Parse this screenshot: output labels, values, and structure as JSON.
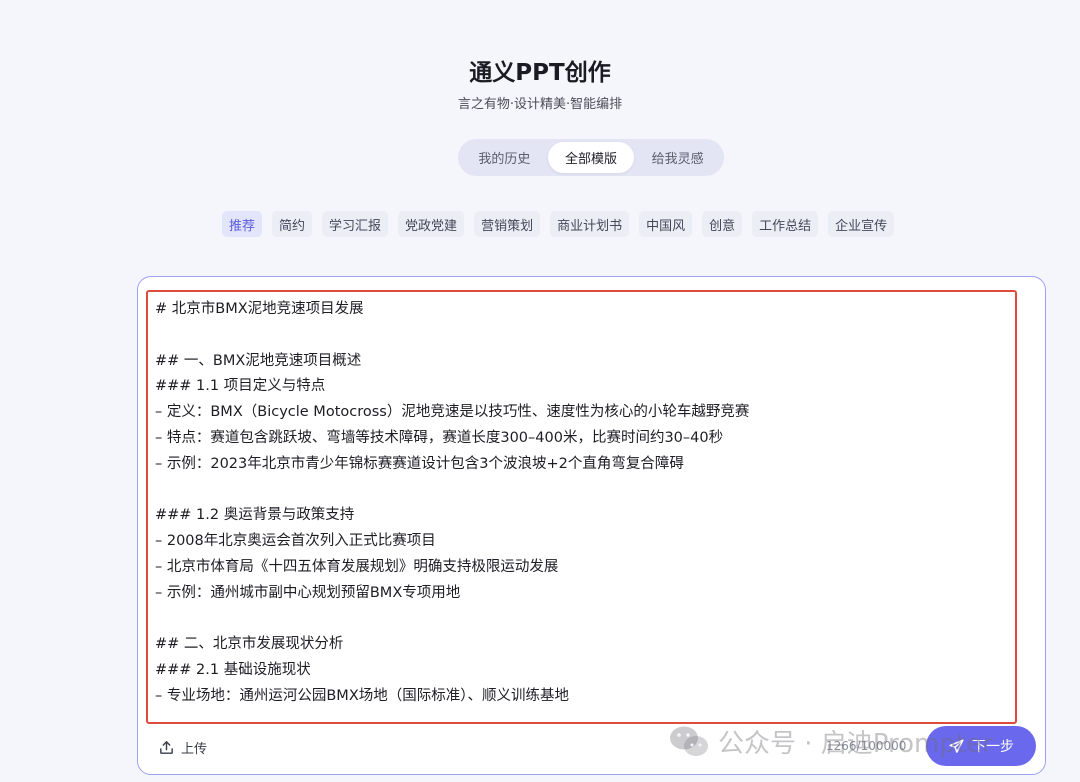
{
  "header": {
    "title": "通义PPT创作",
    "subtitle": "言之有物·设计精美·智能编排"
  },
  "segmented_tabs": [
    {
      "label": "我的历史",
      "active": false
    },
    {
      "label": "全部模版",
      "active": true
    },
    {
      "label": "给我灵感",
      "active": false
    }
  ],
  "categories": [
    {
      "label": "推荐",
      "active": true
    },
    {
      "label": "简约",
      "active": false
    },
    {
      "label": "学习汇报",
      "active": false
    },
    {
      "label": "党政党建",
      "active": false
    },
    {
      "label": "营销策划",
      "active": false
    },
    {
      "label": "商业计划书",
      "active": false
    },
    {
      "label": "中国风",
      "active": false
    },
    {
      "label": "创意",
      "active": false
    },
    {
      "label": "工作总结",
      "active": false
    },
    {
      "label": "企业宣传",
      "active": false
    }
  ],
  "editor": {
    "lines": [
      "# 北京市BMX泥地竞速项目发展",
      "",
      "## 一、BMX泥地竞速项目概述",
      "### 1.1 项目定义与特点",
      "– 定义：BMX（Bicycle Motocross）泥地竞速是以技巧性、速度性为核心的小轮车越野竞赛",
      "– 特点：赛道包含跳跃坡、弯墙等技术障碍，赛道长度300–400米，比赛时间约30–40秒",
      "– 示例：2023年北京市青少年锦标赛赛道设计包含3个波浪坡+2个直角弯复合障碍",
      "",
      "### 1.2 奥运背景与政策支持",
      "– 2008年北京奥运会首次列入正式比赛项目",
      "– 北京市体育局《十四五体育发展规划》明确支持极限运动发展",
      "– 示例：通州城市副中心规划预留BMX专项用地",
      "",
      "## 二、北京市发展现状分析",
      "### 2.1 基础设施现状",
      "– 专业场地：通州运河公园BMX场地（国际标准）、顺义训练基地"
    ]
  },
  "footer": {
    "upload_label": "上传",
    "char_count": "1266/100000",
    "next_label": "下一步"
  },
  "watermark": {
    "text": "公众号 · 启迪Prompter"
  },
  "colors": {
    "accent": "#6a68ec",
    "highlight_border": "#de4b3d",
    "card_border": "#9da1f2",
    "background": "#f5f6fb"
  }
}
